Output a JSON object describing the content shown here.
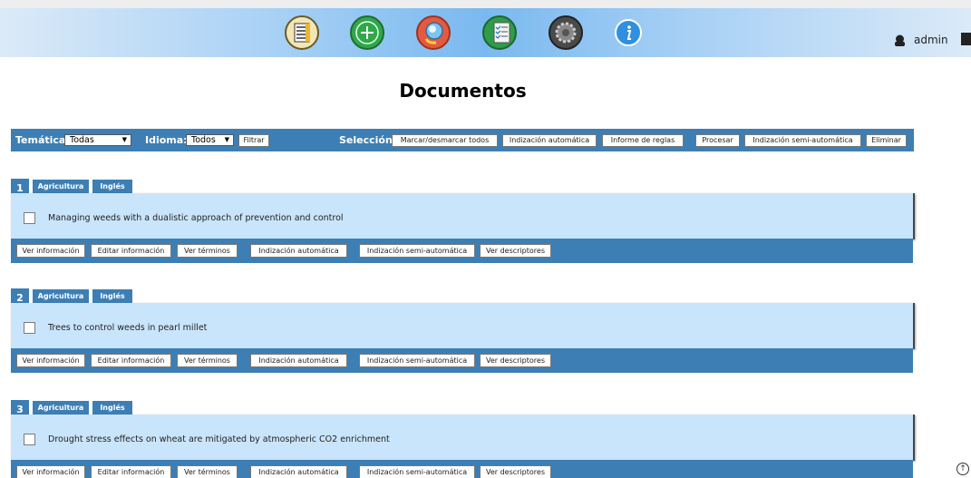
{
  "nav": {
    "icons": [
      "documents-icon",
      "add-icon",
      "search-icon",
      "checklist-icon",
      "settings-icon",
      "info-icon"
    ]
  },
  "user": {
    "name": "admin"
  },
  "page": {
    "title": "Documentos"
  },
  "filters": {
    "tematica_label": "Temática:",
    "tematica_value": "Todas",
    "idioma_label": "Idioma:",
    "idioma_value": "Todos",
    "filtrar": "Filtrar",
    "seleccion_label": "Selección:",
    "actions": [
      "Marcar/desmarcar todos",
      "Indización automática",
      "Informe de reglas",
      "Procesar",
      "Indización semi-automática",
      "Eliminar"
    ]
  },
  "doc_actions": [
    "Ver información",
    "Editar información",
    "Ver términos",
    "Indización automática",
    "Indización semi-automática",
    "Ver descriptores"
  ],
  "documents": [
    {
      "num": "1",
      "tags": [
        "Agricultura",
        "Inglés"
      ],
      "title": "Managing weeds with a dualistic approach of prevention and control"
    },
    {
      "num": "2",
      "tags": [
        "Agricultura",
        "Inglés"
      ],
      "title": "Trees to control weeds in pearl millet"
    },
    {
      "num": "3",
      "tags": [
        "Agricultura",
        "Inglés"
      ],
      "title": "Drought stress effects on wheat are mitigated by atmospheric CO2 enrichment"
    }
  ],
  "colors": {
    "bar": "#3d7fb5",
    "row_bg": "#c9e5fb"
  }
}
